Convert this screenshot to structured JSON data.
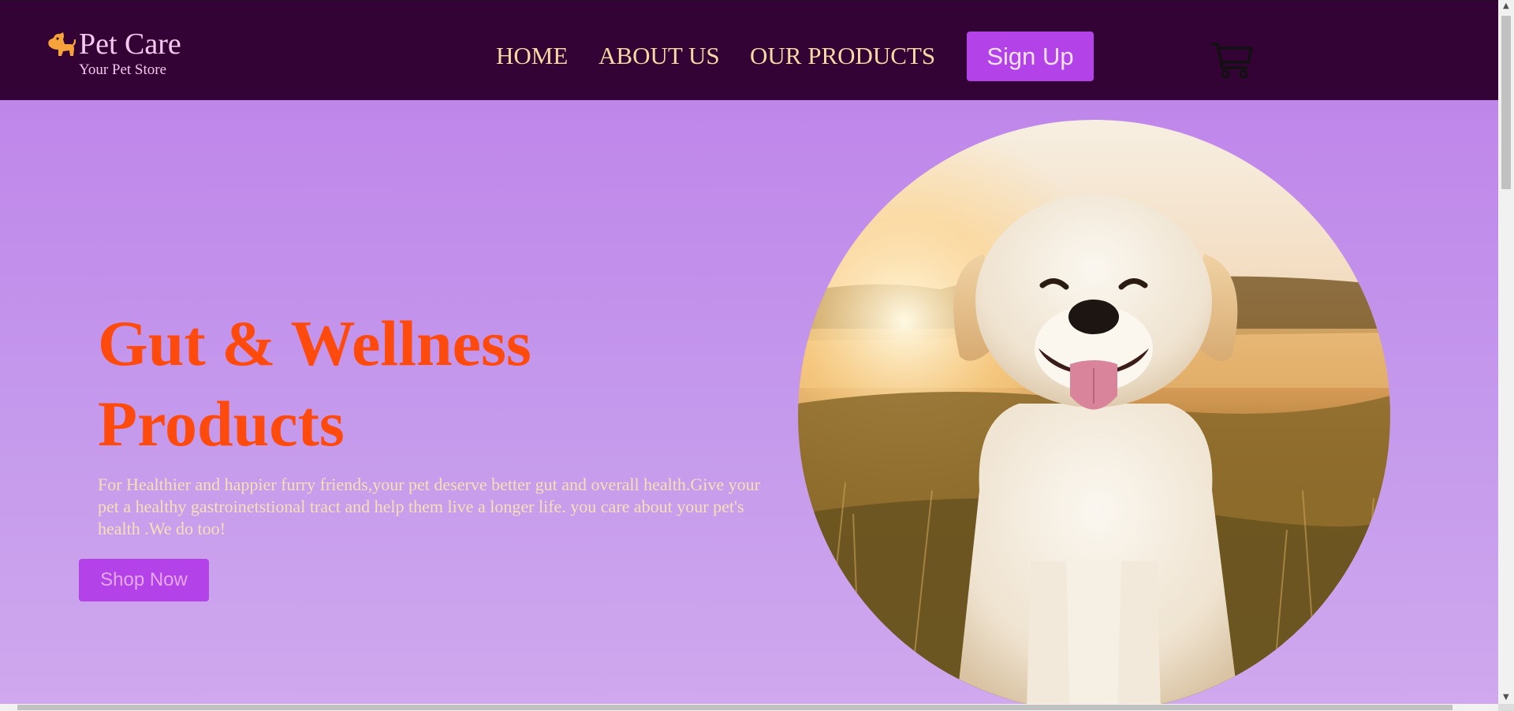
{
  "brand": {
    "title": "Pet Care",
    "subtitle": "Your Pet Store",
    "icon": "dog-icon"
  },
  "nav": {
    "items": [
      "HOME",
      "ABOUT US",
      "OUR PRODUCTS"
    ],
    "signup_label": "Sign Up",
    "cart_icon": "cart-icon"
  },
  "hero": {
    "title_line1": "Gut & Wellness",
    "title_line2": "Products",
    "description": "For Healthier and happier furry friends,your pet deserve better gut and overall health.Give your pet a healthy gastroinetstional tract and help them live a longer life. you care about your pet's health .We do too!",
    "cta_label": "Shop Now",
    "image": "smiling golden retriever puppy at sunset"
  },
  "colors": {
    "header_bg": "#330335",
    "hero_bg": "#c59aec",
    "title_color": "#ff4a0d",
    "button_bg": "#b343e8",
    "nav_text": "#f6d9a3"
  }
}
